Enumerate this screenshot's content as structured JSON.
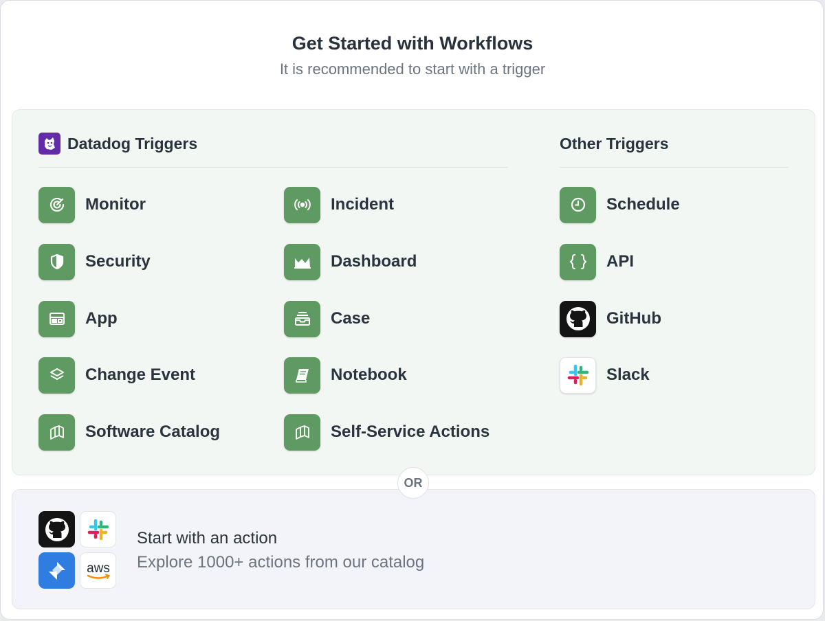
{
  "header": {
    "title": "Get Started with Workflows",
    "subtitle": "It is recommended to start with a trigger"
  },
  "datadog_triggers": {
    "heading": "Datadog Triggers",
    "logo_icon": "datadog-logo",
    "items": [
      {
        "label": "Monitor",
        "icon": "monitor-icon"
      },
      {
        "label": "Incident",
        "icon": "incident-icon"
      },
      {
        "label": "Security",
        "icon": "security-shield-icon"
      },
      {
        "label": "Dashboard",
        "icon": "dashboard-chart-icon"
      },
      {
        "label": "App",
        "icon": "app-layout-icon"
      },
      {
        "label": "Case",
        "icon": "case-inbox-icon"
      },
      {
        "label": "Change Event",
        "icon": "change-event-layers-icon"
      },
      {
        "label": "Notebook",
        "icon": "notebook-icon"
      },
      {
        "label": "Software Catalog",
        "icon": "software-catalog-icon"
      },
      {
        "label": "Self-Service Actions",
        "icon": "self-service-actions-icon"
      }
    ]
  },
  "other_triggers": {
    "heading": "Other Triggers",
    "items": [
      {
        "label": "Schedule",
        "icon": "clock-icon"
      },
      {
        "label": "API",
        "icon": "braces-icon"
      },
      {
        "label": "GitHub",
        "icon": "github-icon"
      },
      {
        "label": "Slack",
        "icon": "slack-icon"
      }
    ]
  },
  "divider": {
    "label": "OR"
  },
  "action": {
    "title": "Start with an action",
    "subtitle": "Explore 1000+ actions from our catalog",
    "icons": [
      "github-icon",
      "slack-icon",
      "jira-icon",
      "aws-icon"
    ],
    "aws_text": "aws"
  },
  "colors": {
    "trigger_icon_bg": "#5e9a61",
    "triggers_panel_bg": "#f3f7f4",
    "action_panel_bg": "#f3f4fa",
    "datadog_purple": "#632ca6"
  }
}
